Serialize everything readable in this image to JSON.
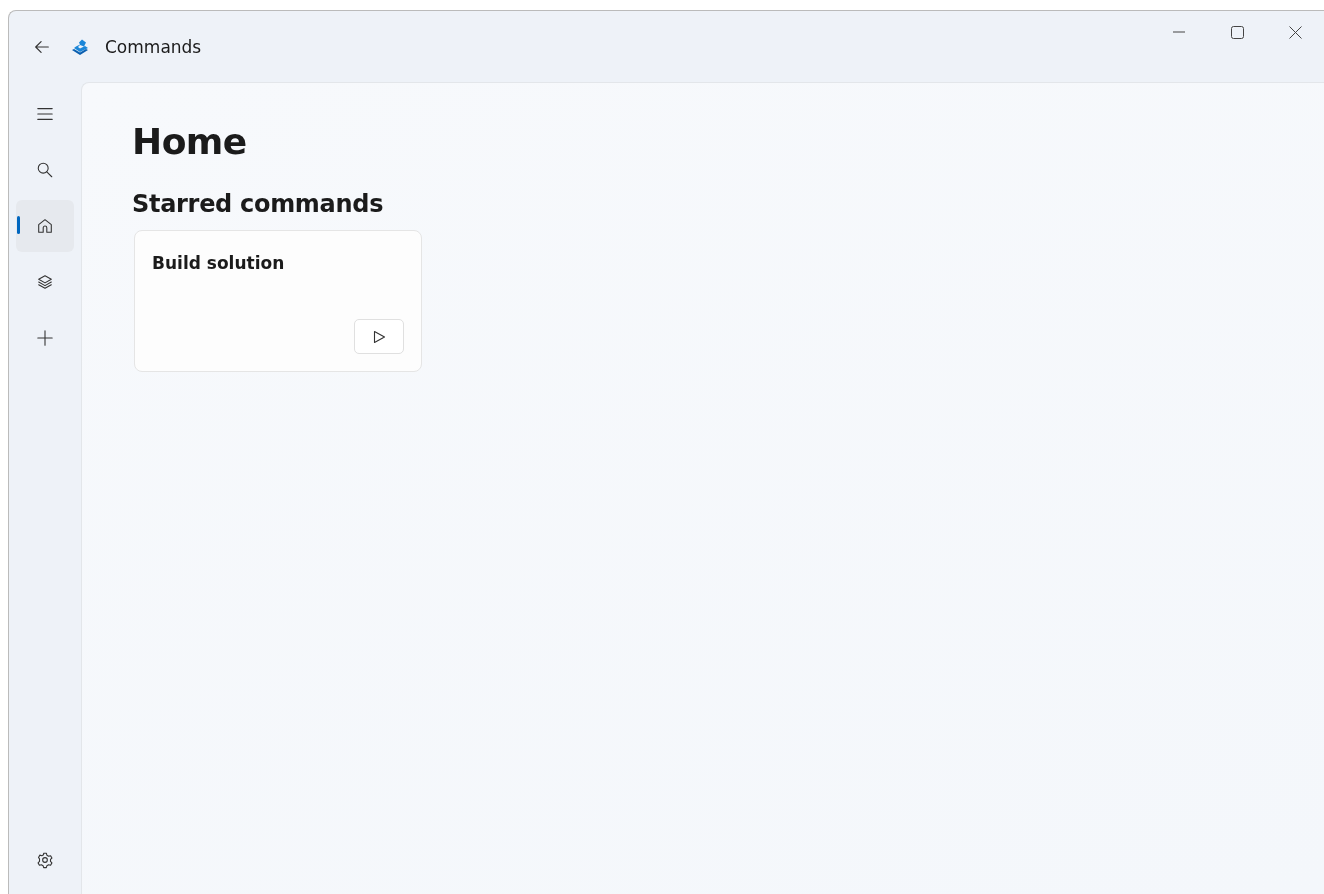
{
  "window": {
    "title": "Commands"
  },
  "nav": {
    "items": [
      {
        "kind": "menu",
        "selected": false
      },
      {
        "kind": "search",
        "selected": false
      },
      {
        "kind": "home",
        "selected": true
      },
      {
        "kind": "layers",
        "selected": false
      },
      {
        "kind": "add",
        "selected": false
      }
    ],
    "footer": [
      {
        "kind": "settings",
        "selected": false
      }
    ]
  },
  "page": {
    "title": "Home",
    "section": "Starred commands",
    "cards": [
      {
        "title": "Build solution"
      }
    ]
  }
}
